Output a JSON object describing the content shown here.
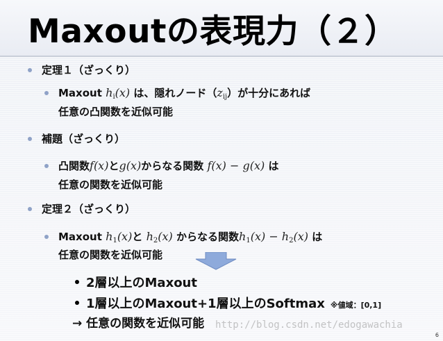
{
  "title": "Maxoutの表現力（２）",
  "theorem1": {
    "heading": "定理１（ざっくり）",
    "sub": {
      "pre": "Maxout",
      "mid": "は、隠れノード（",
      "post": "）が十分にあれば",
      "line2": "任意の凸関数を近似可能"
    }
  },
  "lemma": {
    "heading": "補題（ざっくり）",
    "sub": {
      "pre": "凸関数",
      "and": "と",
      "mid": "からなる関数",
      "post": "は",
      "line2": "任意の関数を近似可能"
    }
  },
  "theorem2": {
    "heading": "定理２（ざっくり）",
    "sub": {
      "pre": "Maxout",
      "and": "と",
      "mid": "からなる関数",
      "post": "は",
      "line2": "任意の関数を近似可能"
    }
  },
  "conclusion": {
    "item1": "2層以上のMaxout",
    "item2": "1層以上のMaxout+1層以上のSoftmax",
    "note": "※値域：[0,1]",
    "result": "→ 任意の関数を近似可能"
  },
  "watermark": "http://blog.csdn.net/edogawachia",
  "page_number": "6",
  "colors": {
    "bullet": "#8fa2c7",
    "arrow_fill": "#8eaadb",
    "arrow_stroke": "#6f8cc2"
  }
}
